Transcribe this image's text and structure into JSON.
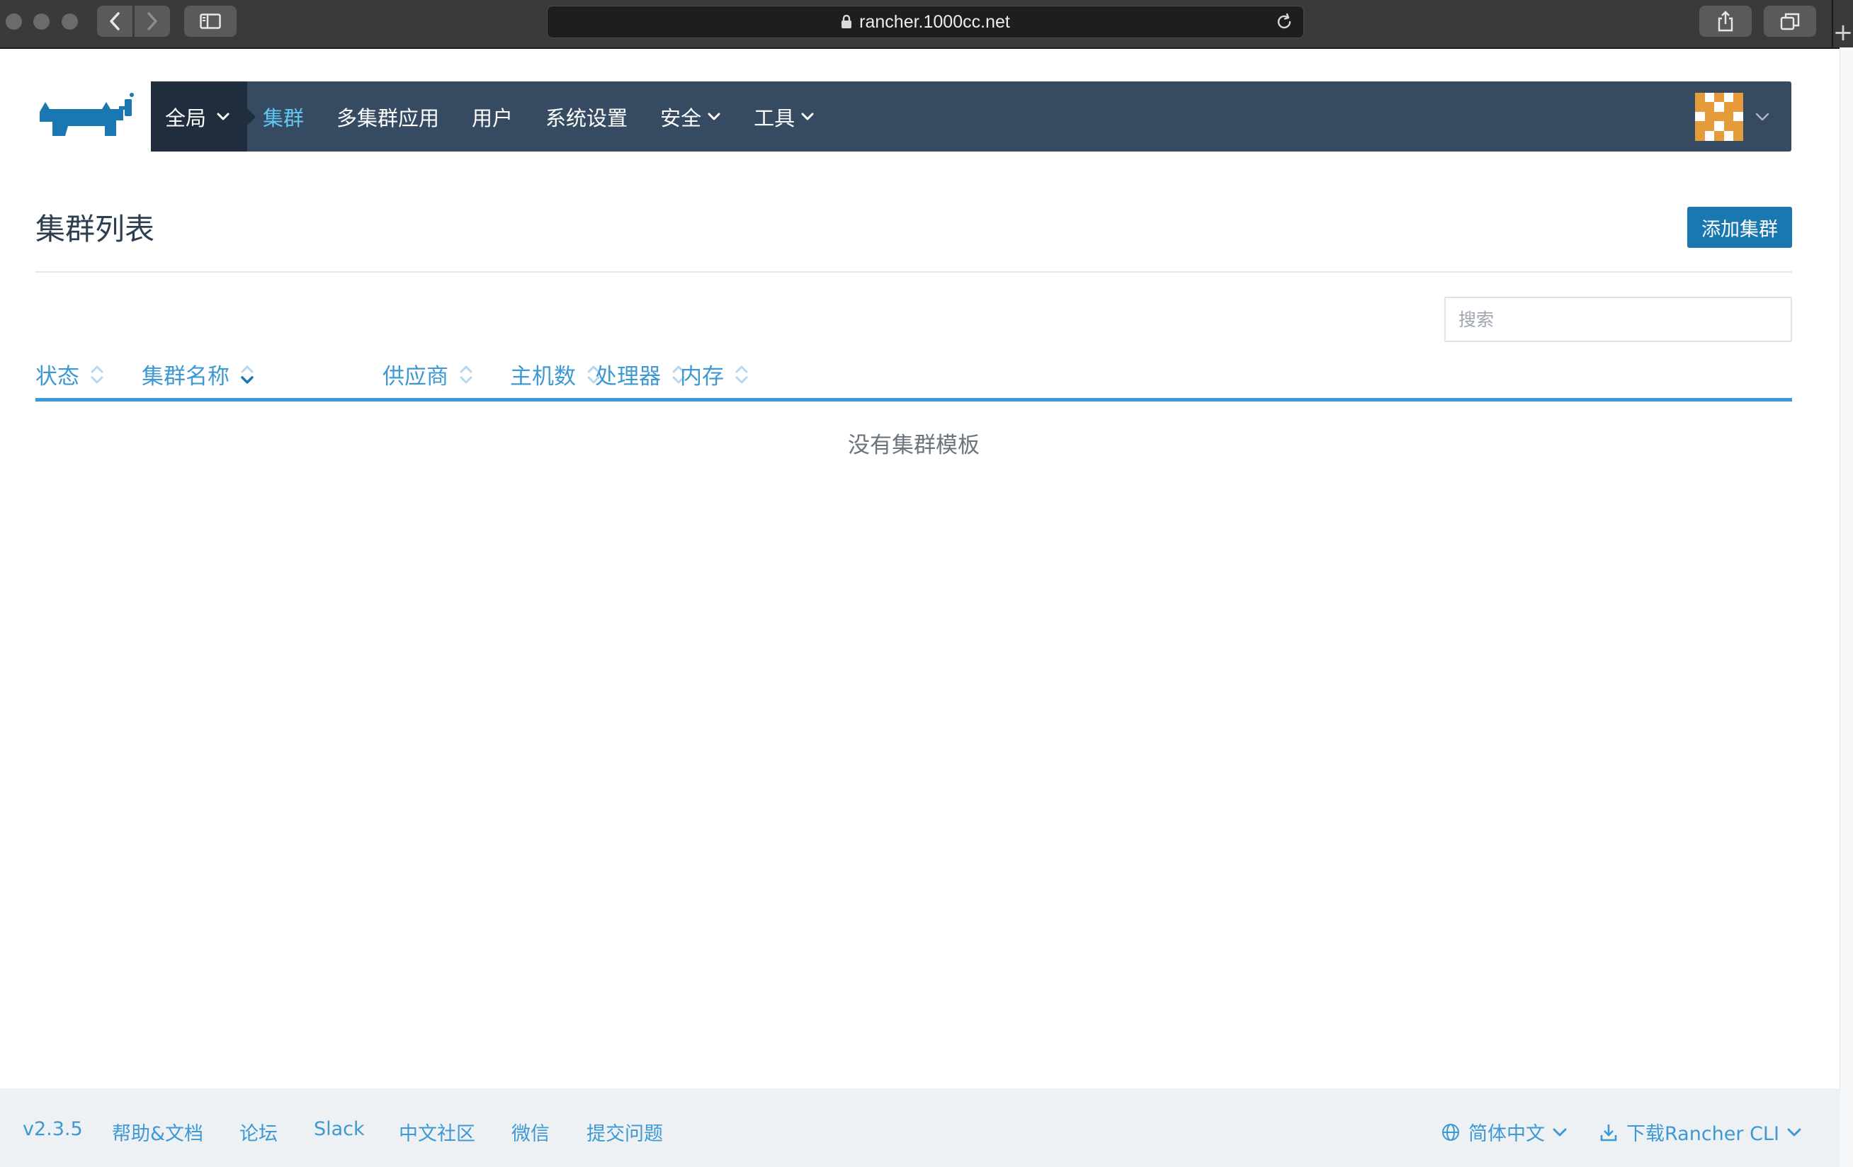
{
  "browser": {
    "url": "rancher.1000cc.net"
  },
  "nav": {
    "scope_label": "全局",
    "items": [
      {
        "label": "集群",
        "active": true,
        "dropdown": false
      },
      {
        "label": "多集群应用",
        "active": false,
        "dropdown": false
      },
      {
        "label": "用户",
        "active": false,
        "dropdown": false
      },
      {
        "label": "系统设置",
        "active": false,
        "dropdown": false
      },
      {
        "label": "安全",
        "active": false,
        "dropdown": true
      },
      {
        "label": "工具",
        "active": false,
        "dropdown": true
      }
    ]
  },
  "page": {
    "title": "集群列表",
    "add_button": "添加集群",
    "search_placeholder": "搜索",
    "columns": [
      "状态",
      "集群名称",
      "供应商",
      "主机数",
      "处理器",
      "内存"
    ],
    "sorted_column": "集群名称",
    "empty_message": "没有集群模板"
  },
  "footer": {
    "version": "v2.3.5",
    "links": [
      "帮助&文档",
      "论坛",
      "Slack",
      "中文社区",
      "微信",
      "提交问题"
    ],
    "language": "简体中文",
    "cli": "下载Rancher CLI"
  },
  "colors": {
    "nav_bg": "#364a61",
    "scope_bg": "#1f2d3d",
    "active_nav": "#61c6f0",
    "primary": "#1b77b0",
    "link": "#3d98d3",
    "avatar_orange": "#e59b3a"
  }
}
